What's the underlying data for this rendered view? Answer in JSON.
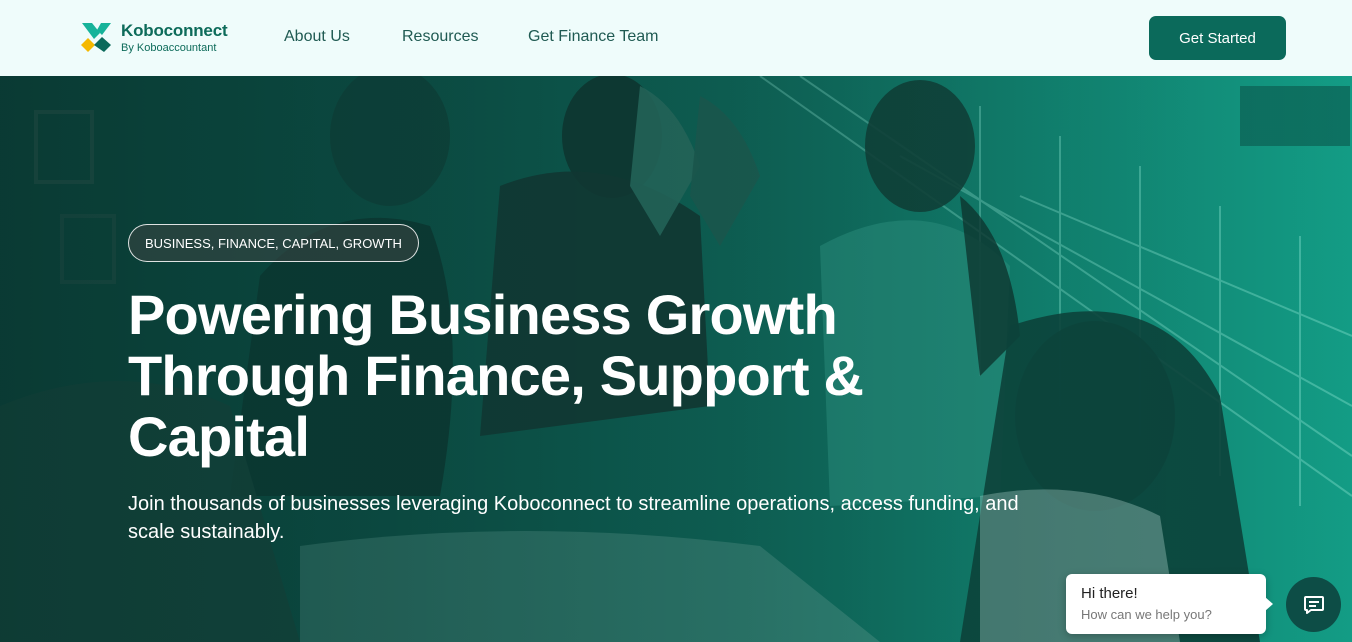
{
  "header": {
    "brand_name": "Koboconnect",
    "brand_sub": "By Koboaccountant",
    "nav": [
      {
        "label": "About Us"
      },
      {
        "label": "Resources"
      },
      {
        "label": "Get Finance Team"
      }
    ],
    "cta_label": "Get Started"
  },
  "hero": {
    "tag": "BUSINESS, FINANCE, CAPITAL, GROWTH",
    "headline": "Powering Business Growth Through Finance, Support & Capital",
    "subtext": "Join thousands of businesses leveraging Koboconnect to streamline operations, access funding, and scale sustainably.",
    "image_subject": "group of people high-fiving"
  },
  "chat": {
    "title": "Hi there!",
    "prompt": "How can we help you?",
    "icon": "chat-icon"
  },
  "colors": {
    "brand": "#0b6a5b",
    "nav_bg": "#effcfb",
    "logo_yellow": "#f5b800",
    "logo_teal": "#17b39a"
  }
}
